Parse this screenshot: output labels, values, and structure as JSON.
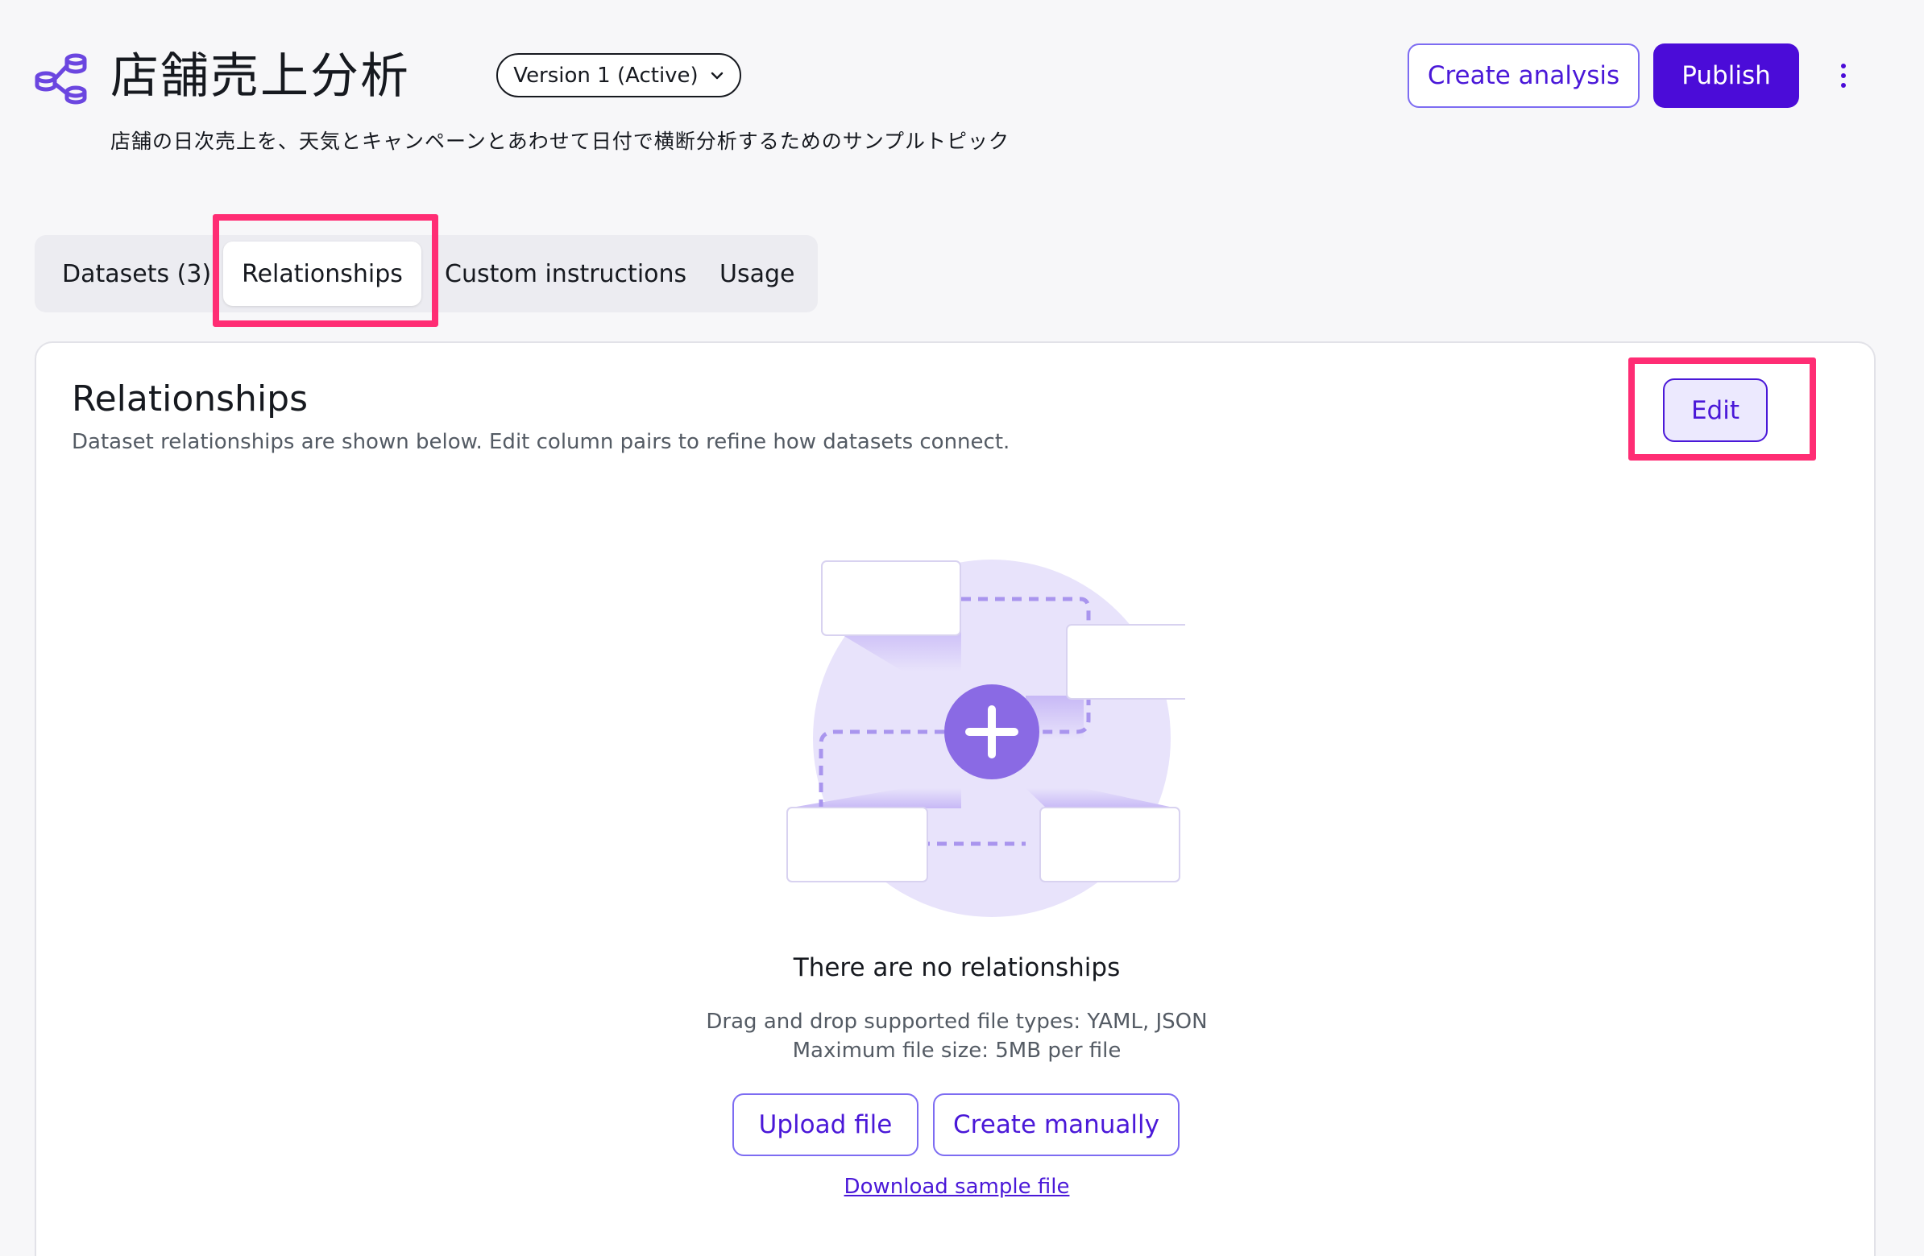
{
  "header": {
    "title": "店舗売上分析",
    "version_label": "Version 1 (Active)",
    "description": "店舗の日次売上を、天気とキャンペーンとあわせて日付で横断分析するためのサンプルトピック",
    "create_analysis_label": "Create analysis",
    "publish_label": "Publish",
    "icons": {
      "topic": "topic-network-icon",
      "version": "chevron-down-icon",
      "more": "more-vertical-icon"
    }
  },
  "tabs": [
    {
      "label": "Datasets (3)",
      "selected": false
    },
    {
      "label": "Relationships",
      "selected": true
    },
    {
      "label": "Custom instructions",
      "selected": false
    },
    {
      "label": "Usage",
      "selected": false
    }
  ],
  "panel": {
    "title": "Relationships",
    "description": "Dataset relationships are shown below. Edit column pairs to refine how datasets connect.",
    "edit_label": "Edit",
    "empty_state": {
      "title": "There are no relationships",
      "line1": "Drag and drop supported file types: YAML, JSON",
      "line2": "Maximum file size: 5MB per file",
      "upload_label": "Upload file",
      "create_label": "Create manually",
      "download_label": "Download sample file"
    }
  },
  "colors": {
    "accent": "#4b0cd8",
    "accent_light": "#ece9fe",
    "highlight": "#ff2d74",
    "illustration_circle": "#e8e3fb",
    "plus_circle": "#8a6ae4"
  }
}
